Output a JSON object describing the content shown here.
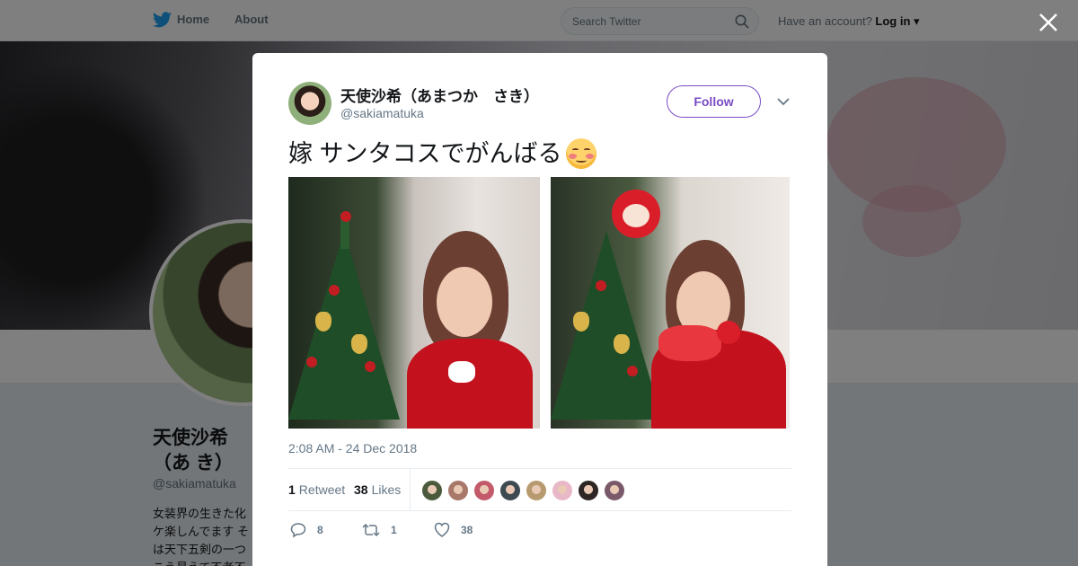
{
  "topnav": {
    "home_label": "Home",
    "about_label": "About",
    "search_placeholder": "Search Twitter",
    "account_prompt": "Have an account?",
    "login_label": "Log in"
  },
  "profile": {
    "name": "天使沙希（あまつかさき）",
    "name_visible": "天使沙希（あ き）",
    "handle": "@sakiamatuka",
    "bio_lines": [
      "女装界の生きた化",
      "ケ楽しんでます そ",
      "は天下五剣の一つ",
      "こう見えて不老不"
    ]
  },
  "tweet": {
    "author_name": "天使沙希（あまつか　さき）",
    "author_handle": "@sakiamatuka",
    "follow_label": "Follow",
    "text": "嫁 サンタコスでがんばる",
    "emoji_icon": "relieved-blushing-face-icon",
    "timestamp": "2:08 AM - 24 Dec 2018",
    "retweets_count": "1",
    "retweets_label": "Retweet",
    "likes_count": "38",
    "likes_label": "Likes",
    "reply_count": "8",
    "retweet_action_count": "1",
    "like_action_count": "38",
    "liker_colors": [
      "#4b5a3c",
      "#a8786a",
      "#c35a6a",
      "#3d4a52",
      "#b89a70",
      "#e8b8c8",
      "#2e2624",
      "#7a5a6a"
    ]
  },
  "colors": {
    "accent": "#794bc4",
    "link": "#1da1f2",
    "muted": "#657786"
  }
}
